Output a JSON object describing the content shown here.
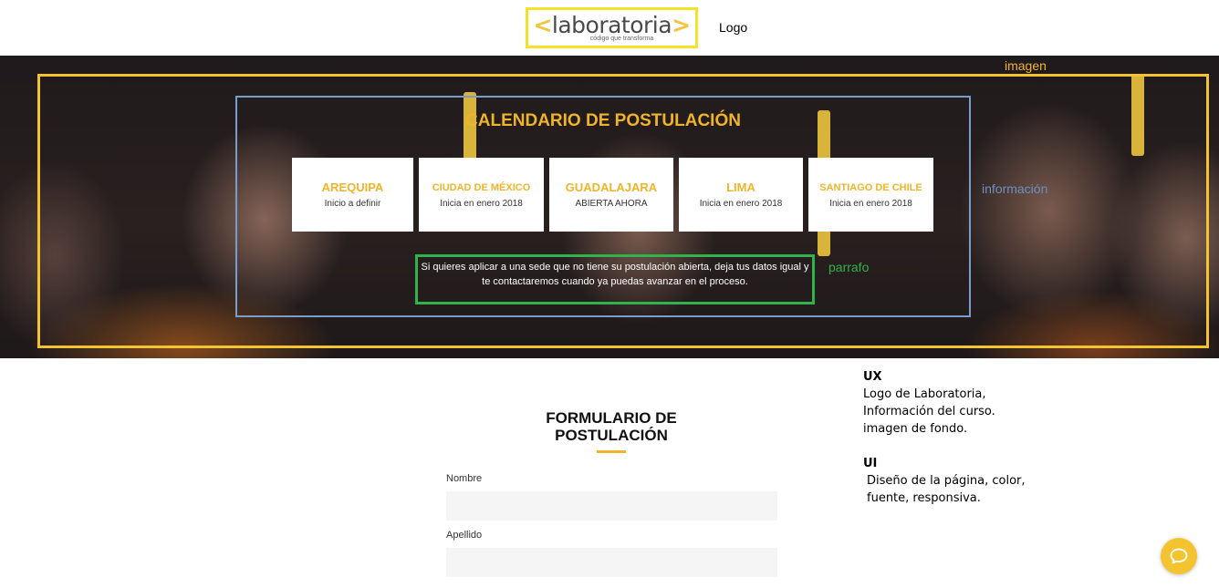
{
  "header": {
    "logo_text": "laboratoria",
    "logo_tagline": "código que transforma",
    "logo_annotation": "Logo"
  },
  "hero": {
    "annotation_image": "imagen",
    "annotation_info": "información",
    "annotation_paragraph": "parrafo",
    "title": "CALENDARIO DE POSTULACIÓN",
    "cards": [
      {
        "city": "AREQUIPA",
        "status": "Inicio a definir"
      },
      {
        "city": "CIUDAD DE MÉXICO",
        "status": "Inicia en enero 2018"
      },
      {
        "city": "GUADALAJARA",
        "status": "ABIERTA AHORA"
      },
      {
        "city": "LIMA",
        "status": "Inicia en enero 2018"
      },
      {
        "city": "SANTIAGO DE CHILE",
        "status": "Inicia en enero 2018"
      }
    ],
    "paragraph": "Si quieres aplicar a una sede que no tiene su postulación abierta, deja tus datos igual y te contactaremos cuando  ya puedas avanzar en el proceso."
  },
  "form": {
    "title_line1": "FORMULARIO DE",
    "title_line2": "POSTULACIÓN",
    "fields": [
      {
        "label": "Nombre",
        "value": "",
        "placeholder": ""
      },
      {
        "label": "Apellido",
        "value": "",
        "placeholder": ""
      }
    ]
  },
  "notes": {
    "ux_heading": "UX",
    "ux_lines": [
      "Logo de Laboratoria,",
      "Información del curso.",
      "imagen de fondo."
    ],
    "ui_heading": "UI",
    "ui_lines": [
      "Diseño de la página, color,",
      "fuente, responsiva."
    ]
  },
  "chat": {
    "icon": "chat-bubble-icon"
  },
  "colors": {
    "accent": "#f0b429",
    "image_frame": "#f4c430",
    "info_frame": "#7a9cc8",
    "paragraph_frame": "#2fb34a",
    "logo_frame": "#f4e12a"
  }
}
